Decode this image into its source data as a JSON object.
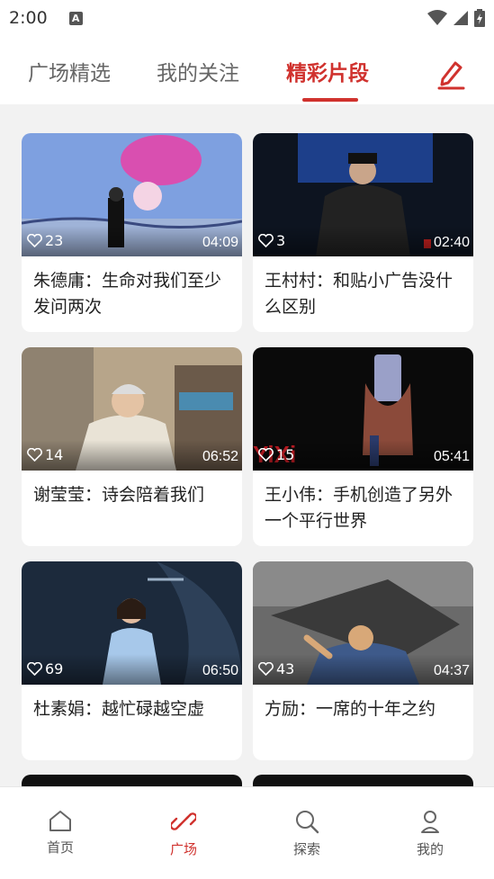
{
  "status": {
    "time": "2:00",
    "notif": "A"
  },
  "tabs": [
    {
      "label": "广场精选"
    },
    {
      "label": "我的关注"
    },
    {
      "label": "精彩片段"
    }
  ],
  "cards": [
    {
      "likes": "23",
      "duration": "04:09",
      "title": "朱德庸：生命对我们至少发问两次"
    },
    {
      "likes": "3",
      "duration": "02:40",
      "title": "王村村：和贴小广告没什么区别"
    },
    {
      "likes": "14",
      "duration": "06:52",
      "title": "谢莹莹：诗会陪着我们"
    },
    {
      "likes": "15",
      "duration": "05:41",
      "title": "王小伟：手机创造了另外一个平行世界"
    },
    {
      "likes": "69",
      "duration": "06:50",
      "title": "杜素娟：越忙碌越空虚"
    },
    {
      "likes": "43",
      "duration": "04:37",
      "title": "方励：一席的十年之约"
    }
  ],
  "thumbs": [
    {
      "bg": "#6f8fd0"
    },
    {
      "bg": "#0d1420"
    },
    {
      "bg": "#b7a58a"
    },
    {
      "bg": "#0a0a0a"
    },
    {
      "bg": "#1c2a3c"
    },
    {
      "bg": "#5c5c5c"
    }
  ],
  "nav": [
    {
      "label": "首页"
    },
    {
      "label": "广场"
    },
    {
      "label": "探索"
    },
    {
      "label": "我的"
    }
  ],
  "colors": {
    "accent": "#d0322e"
  }
}
